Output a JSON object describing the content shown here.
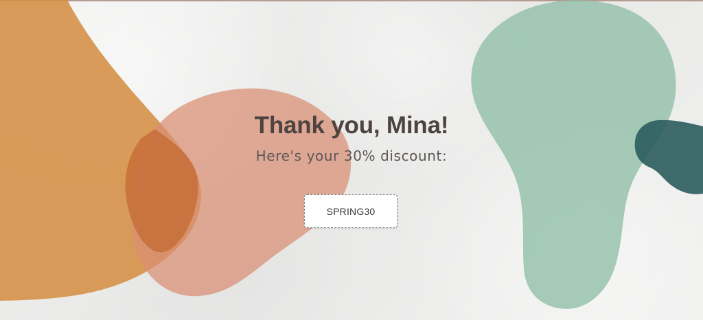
{
  "hero": {
    "headline": "Thank you, Mina!",
    "subheadline": "Here's your 30% discount:"
  },
  "coupon": {
    "code": "SPRING30"
  },
  "colors": {
    "orange_blob": "#d58e43",
    "coral_blob": "#d88e73",
    "green_blob": "#8ebea6",
    "teal_blob": "#2f5e61",
    "text_dark": "#4d4341",
    "button_bg": "#ffffff"
  }
}
